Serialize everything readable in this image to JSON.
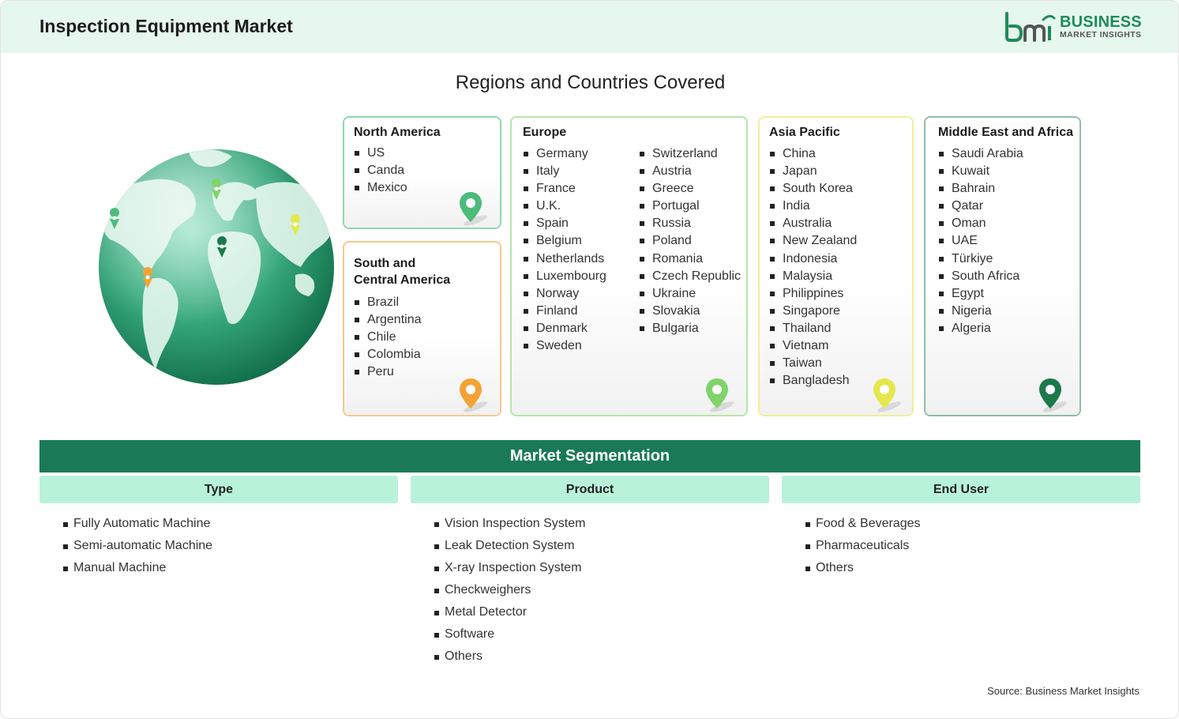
{
  "header": {
    "title": "Inspection Equipment Market",
    "logo": {
      "line1": "BUSINESS",
      "line2": "MARKET INSIGHTS",
      "color": "#1f8a5a"
    }
  },
  "regions_title": "Regions and Countries Covered",
  "regions": {
    "north_america": {
      "title": "North America",
      "color": "#4dbb7a",
      "items": [
        "US",
        "Canda",
        "Mexico"
      ]
    },
    "south_america": {
      "title_line1": "South and",
      "title_line2": "Central America",
      "color": "#f4a236",
      "items": [
        "Brazil",
        "Argentina",
        "Chile",
        "Colombia",
        "Peru"
      ]
    },
    "europe": {
      "title": "Europe",
      "color": "#7fd46a",
      "items_col1": [
        "Germany",
        "Italy",
        "France",
        "U.K.",
        "Spain",
        "Belgium",
        "Netherlands",
        "Luxembourg",
        "Norway",
        "Finland",
        "Denmark",
        "Sweden"
      ],
      "items_col2": [
        "Switzerland",
        "Austria",
        "Greece",
        "Portugal",
        "Russia",
        "Poland",
        "Romania",
        "Czech Republic",
        "Ukraine",
        "Slovakia",
        "Bulgaria"
      ]
    },
    "asia_pacific": {
      "title": "Asia Pacific",
      "color": "#e4e84a",
      "items": [
        "China",
        "Japan",
        "South Korea",
        "India",
        "Australia",
        "New Zealand",
        "Indonesia",
        "Malaysia",
        "Philippines",
        "Singapore",
        "Thailand",
        "Vietnam",
        "Taiwan",
        "Bangladesh"
      ]
    },
    "middle_east_africa": {
      "title": "Middle East and Africa",
      "color": "#1a7a4a",
      "items": [
        "Saudi Arabia",
        "Kuwait",
        "Bahrain",
        "Qatar",
        "Oman",
        "UAE",
        "Türkiye",
        "South Africa",
        "Egypt",
        "Nigeria",
        "Algeria"
      ]
    }
  },
  "segmentation": {
    "title": "Market Segmentation",
    "columns": [
      {
        "heading": "Type",
        "items": [
          "Fully Automatic Machine",
          "Semi-automatic Machine",
          "Manual Machine"
        ]
      },
      {
        "heading": "Product",
        "items": [
          "Vision Inspection System",
          "Leak Detection System",
          "X-ray Inspection System",
          "Checkweighers",
          "Metal Detector",
          "Software",
          "Others"
        ]
      },
      {
        "heading": "End User",
        "items": [
          "Food & Beverages",
          "Pharmaceuticals",
          "Others"
        ]
      }
    ]
  },
  "source": "Source: Business Market Insights"
}
